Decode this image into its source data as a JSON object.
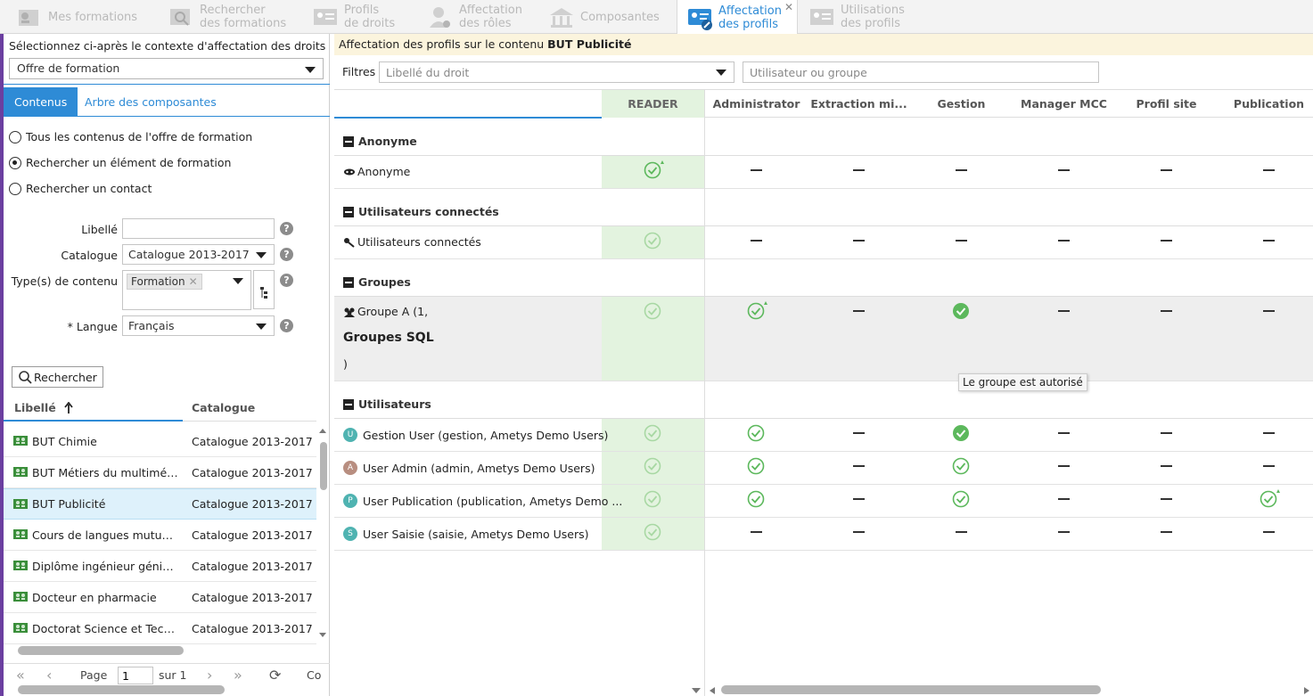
{
  "tabs": [
    {
      "label": "Mes formations",
      "icon": "formations-icon"
    },
    {
      "label": "Rechercher des formations",
      "icon": "search-formations-icon"
    },
    {
      "label": "Profils de droits",
      "icon": "profiles-icon"
    },
    {
      "label": "Affectation des rôles",
      "icon": "user-role-icon"
    },
    {
      "label": "Composantes",
      "icon": "building-icon"
    },
    {
      "label": "Affectation des profils",
      "icon": "profile-assign-icon",
      "active": true
    },
    {
      "label": "Utilisations des profils",
      "icon": "profile-usage-icon"
    }
  ],
  "left": {
    "context_title": "Sélectionnez ci-après le contexte d'affectation des droits",
    "context_value": "Offre de formation",
    "tab_contents": "Contenus",
    "tab_tree": "Arbre des composantes",
    "radio_all": "Tous les contenus de l'offre de formation",
    "radio_search_element": "Rechercher un élément de formation",
    "radio_search_contact": "Rechercher un contact",
    "label_libelle": "Libellé",
    "label_catalogue": "Catalogue",
    "catalogue_value": "Catalogue 2013-2017",
    "label_types": "Type(s) de contenu",
    "type_chip": "Formation",
    "label_langue": "* Langue",
    "langue_value": "Français",
    "search_button": "Rechercher",
    "col_libelle": "Libellé",
    "col_catalogue": "Catalogue",
    "rows": [
      {
        "libelle": "BUT Chimie",
        "catalogue": "Catalogue 2013-2017"
      },
      {
        "libelle": "BUT Métiers du multimédia et de l'internet",
        "catalogue": "Catalogue 2013-2017"
      },
      {
        "libelle": "BUT Publicité",
        "catalogue": "Catalogue 2013-2017",
        "selected": true
      },
      {
        "libelle": "Cours de langues mutualisés",
        "catalogue": "Catalogue 2013-2017"
      },
      {
        "libelle": "Diplôme ingénieur génie des procédés",
        "catalogue": "Catalogue 2013-2017"
      },
      {
        "libelle": "Docteur en pharmacie",
        "catalogue": "Catalogue 2013-2017"
      },
      {
        "libelle": "Doctorat Science et Technologie",
        "catalogue": "Catalogue 2013-2017"
      }
    ],
    "pager": {
      "page_label": "Page",
      "page_value": "1",
      "of_label": "sur 1",
      "extra": "Co"
    }
  },
  "right": {
    "title_prefix": "Affectation des profils sur le contenu",
    "title_content": "BUT Publicité",
    "filters_label": "Filtres",
    "filter_right_placeholder": "Libellé du droit",
    "filter_user_placeholder": "Utilisateur ou groupe",
    "columns": [
      "READER",
      "Administrator",
      "Extraction mi...",
      "Gestion",
      "Manager MCC",
      "Profil site",
      "Publication"
    ],
    "groups": {
      "anonymous": "Anonyme",
      "connected": "Utilisateurs connectés",
      "groups": "Groupes",
      "users": "Utilisateurs"
    },
    "rows": {
      "anonymous": "Anonyme",
      "connected": "Utilisateurs connectés",
      "group_a_line1": "Groupe A (1,",
      "group_a_line2": "Groupes SQL",
      "group_a_line3": ")",
      "user1": "Gestion User (gestion, Ametys Demo Users)",
      "user2": "User Admin (admin, Ametys Demo Users)",
      "user3": "User Publication (publication, Ametys Demo ...",
      "user4": "User Saisie (saisie, Ametys Demo Users)"
    },
    "avatars": {
      "user1": "U",
      "user2": "A",
      "user3": "P",
      "user4": "S"
    },
    "tooltip": "Le groupe est autorisé"
  },
  "colors": {
    "accent": "#2e8bd6",
    "allowed_green": "#5cb85c",
    "reader_bg": "#e3f3df",
    "title_bg": "#fbf4dd"
  }
}
